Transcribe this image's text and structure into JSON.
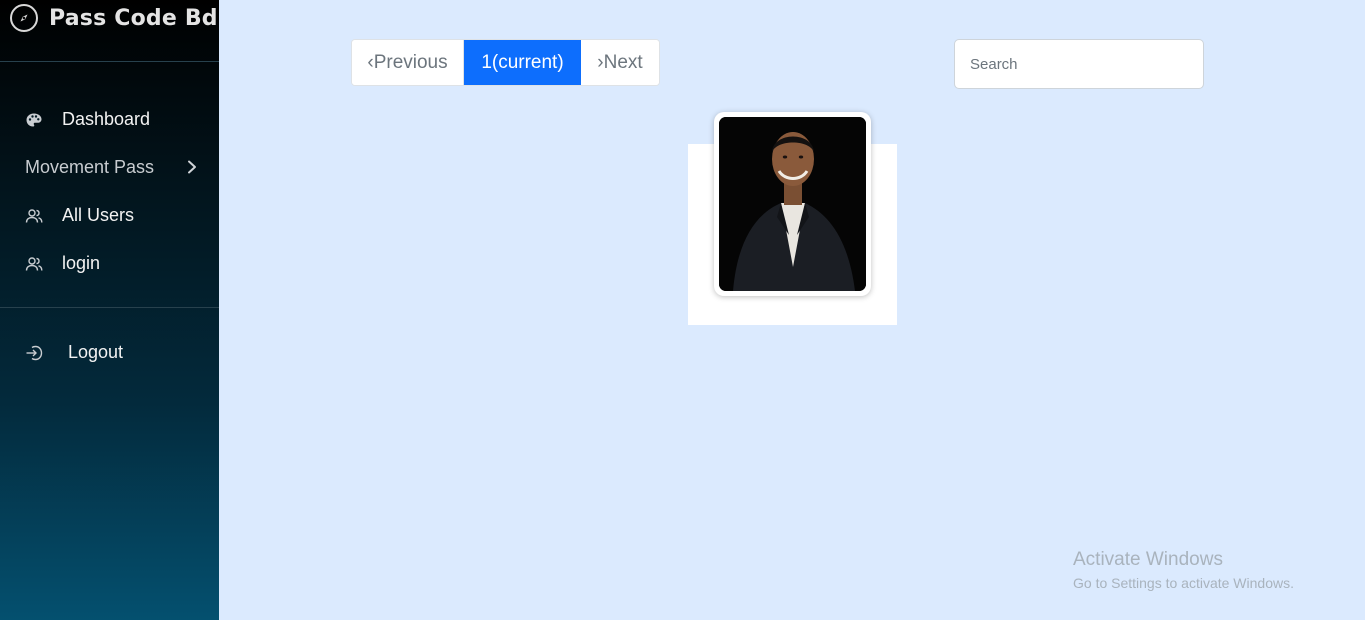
{
  "brand": {
    "title": "Pass Code Bd",
    "icon": "compass-icon"
  },
  "sidebar": {
    "items": [
      {
        "label": "Dashboard",
        "icon": "palette-icon"
      },
      {
        "label": "Movement Pass",
        "icon": "chevron-right-icon"
      },
      {
        "label": "All Users",
        "icon": "users-icon"
      },
      {
        "label": "login",
        "icon": "users-icon"
      }
    ],
    "logout": {
      "label": "Logout",
      "icon": "logout-icon"
    }
  },
  "pagination": {
    "previous": "‹Previous",
    "current": "1(current)",
    "next": "›Next"
  },
  "search": {
    "placeholder": "Search",
    "value": ""
  },
  "watermark": {
    "title": "Activate Windows",
    "subtitle": "Go to Settings to activate Windows."
  },
  "colors": {
    "accent": "#0d6efd",
    "page_background": "#dbeafe",
    "sidebar_top": "#000000",
    "sidebar_bottom": "#04506f"
  }
}
